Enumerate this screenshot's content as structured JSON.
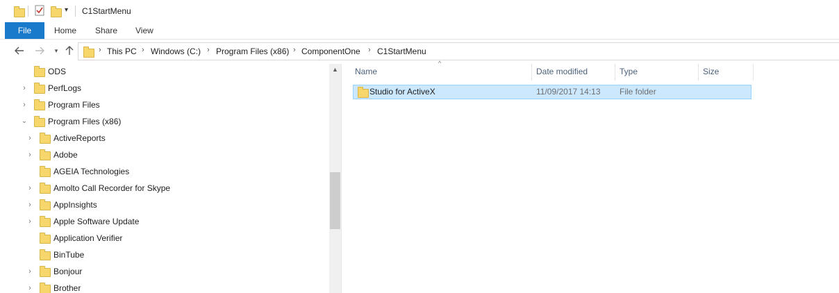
{
  "window": {
    "title": "C1StartMenu"
  },
  "ribbon": {
    "tabs": [
      "File",
      "Home",
      "Share",
      "View"
    ]
  },
  "address": {
    "crumbs": [
      "This PC",
      "Windows (C:)",
      "Program Files (x86)",
      "ComponentOne",
      "C1StartMenu"
    ]
  },
  "tree": {
    "items": [
      {
        "label": "ODS",
        "expandable": false
      },
      {
        "label": "PerfLogs",
        "expandable": true
      },
      {
        "label": "Program Files",
        "expandable": true
      },
      {
        "label": "Program Files (x86)",
        "expandable": true,
        "expanded": true
      },
      {
        "label": "ActiveReports",
        "expandable": true
      },
      {
        "label": "Adobe",
        "expandable": true
      },
      {
        "label": "AGEIA Technologies",
        "expandable": false
      },
      {
        "label": "Amolto Call Recorder for Skype",
        "expandable": true
      },
      {
        "label": "AppInsights",
        "expandable": true
      },
      {
        "label": "Apple Software Update",
        "expandable": true
      },
      {
        "label": "Application Verifier",
        "expandable": false
      },
      {
        "label": "BinTube",
        "expandable": false
      },
      {
        "label": "Bonjour",
        "expandable": true
      },
      {
        "label": "Brother",
        "expandable": true
      }
    ]
  },
  "details": {
    "columns": [
      "Name",
      "Date modified",
      "Type",
      "Size"
    ],
    "rows": [
      {
        "name": "Studio for ActiveX",
        "date": "11/09/2017 14:13",
        "type": "File folder",
        "size": ""
      }
    ]
  },
  "colors": {
    "accent": "#1979ca",
    "selection": "#cce8ff",
    "folder": "#f7d76b"
  },
  "icons": {
    "back": "arrow-left-icon",
    "forward": "arrow-right-icon",
    "recent": "chevron-down-icon",
    "up": "arrow-up-icon"
  }
}
